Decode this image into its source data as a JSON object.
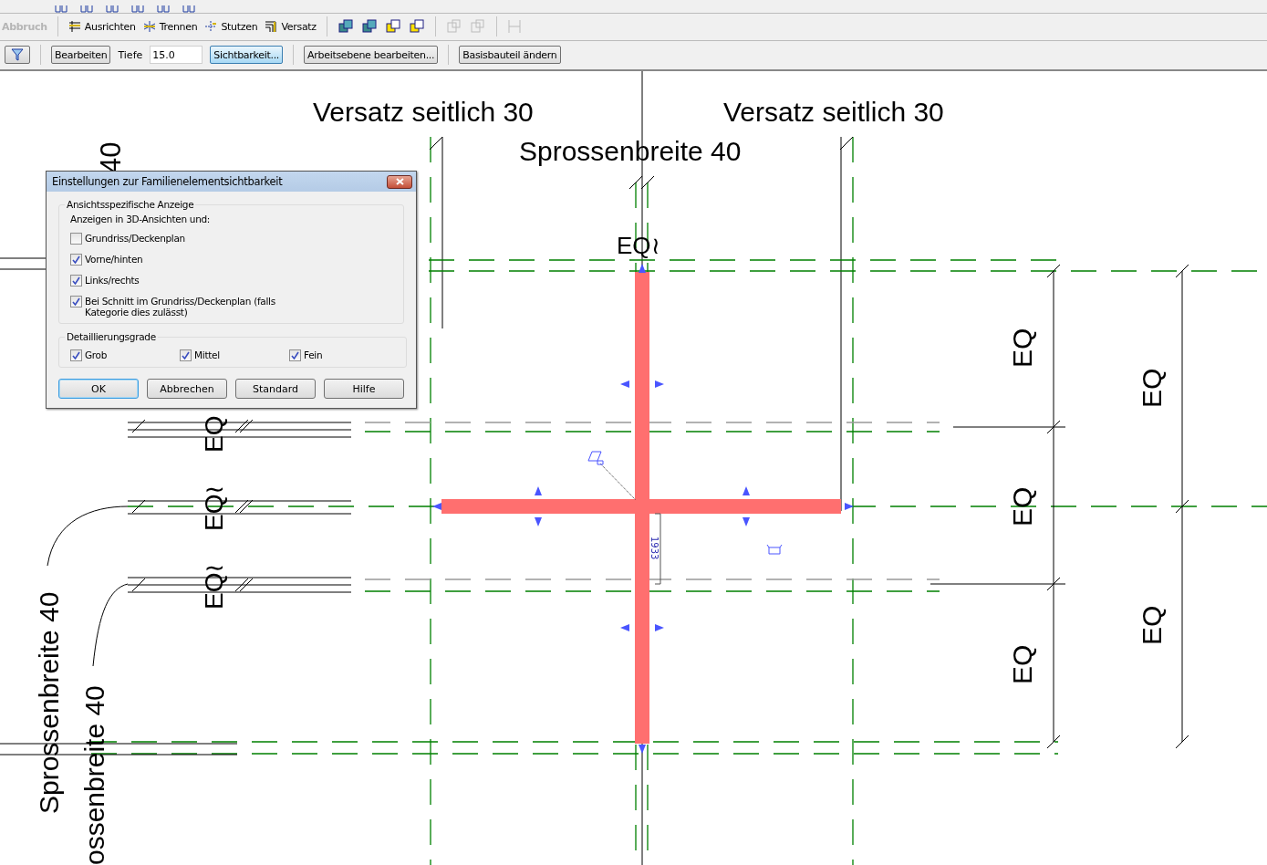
{
  "edit_toolbar": {
    "items": [
      {
        "label": "Abbruch",
        "disabled": true
      },
      {
        "label": "Ausrichten",
        "disabled": false
      },
      {
        "label": "Trennen",
        "disabled": false
      },
      {
        "label": "Stutzen",
        "disabled": false
      },
      {
        "label": "Versatz",
        "disabled": false
      }
    ]
  },
  "options_bar": {
    "edit_button": "Bearbeiten",
    "depth_label": "Tiefe",
    "depth_value": "15.0",
    "buttons": [
      {
        "label": "Sichtbarkeit...",
        "focused": true
      },
      {
        "label": "Arbeitsebene bearbeiten...",
        "focused": false
      },
      {
        "label": "Basisbauteil ändern",
        "focused": false
      }
    ]
  },
  "canvas": {
    "labels": [
      {
        "text": "40",
        "kind": "vertical"
      },
      {
        "text": "Versatz seitlich 30",
        "kind": "horizontal"
      },
      {
        "text": "Versatz seitlich 30",
        "kind": "horizontal"
      },
      {
        "text": "Sprossenbreite 40",
        "kind": "horizontal"
      },
      {
        "text": "EQ≀",
        "kind": "horizontal"
      },
      {
        "text": "EQ",
        "kind": "vertical"
      },
      {
        "text": "EQ",
        "kind": "vertical"
      },
      {
        "text": "EQ",
        "kind": "vertical"
      },
      {
        "text": "EQ",
        "kind": "vertical"
      },
      {
        "text": "EQ",
        "kind": "vertical"
      },
      {
        "text": "EQ",
        "kind": "vertical"
      },
      {
        "text": "EQ≀",
        "kind": "vertical"
      },
      {
        "text": "EQ≀",
        "kind": "vertical"
      },
      {
        "text": "Sprossenbreite 40",
        "kind": "vertical"
      },
      {
        "text": "ossenbreite 40",
        "kind": "vertical"
      }
    ],
    "dimension_value": "1933"
  },
  "dialog": {
    "title": "Einstellungen zur Familienelementsichtbarkeit",
    "sections": [
      {
        "title": "Ansichtsspezifische Anzeige",
        "intro": "Anzeigen in 3D-Ansichten und:",
        "kind": "list",
        "options": [
          {
            "label": "Grundriss/Deckenplan",
            "checked": false
          },
          {
            "label": "Vorne/hinten",
            "checked": true
          },
          {
            "label": "Links/rechts",
            "checked": true
          },
          {
            "label": "Bei Schnitt im Grundriss/Deckenplan (falls Kategorie dies zulässt)",
            "checked": true
          }
        ]
      },
      {
        "title": "Detaillierungsgrade",
        "kind": "row",
        "options": [
          {
            "label": "Grob",
            "checked": true
          },
          {
            "label": "Mittel",
            "checked": true
          },
          {
            "label": "Fein",
            "checked": true
          }
        ]
      }
    ],
    "buttons": [
      {
        "label": "OK",
        "default": true
      },
      {
        "label": "Abbrechen",
        "default": false
      },
      {
        "label": "Standard",
        "default": false
      },
      {
        "label": "Hilfe",
        "default": false
      }
    ]
  }
}
